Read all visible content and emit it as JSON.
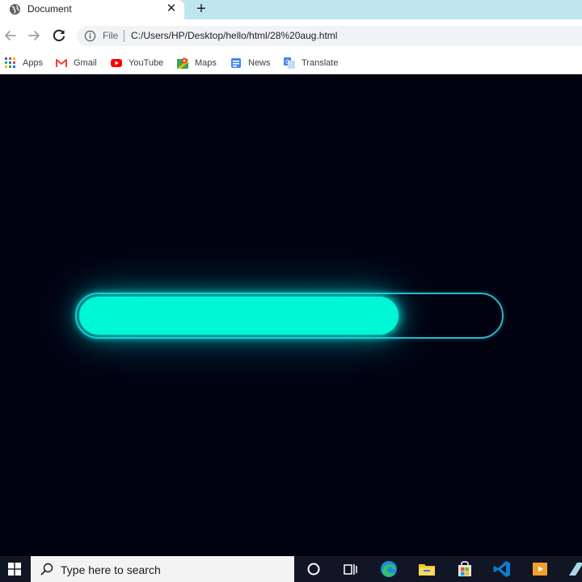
{
  "browser": {
    "tab": {
      "title": "Document",
      "close_glyph": "✕"
    },
    "new_tab_glyph": "+",
    "address": {
      "scheme_label": "File",
      "url": "C:/Users/HP/Desktop/hello/html/28%20aug.html"
    },
    "bookmarks": [
      {
        "label": "Apps",
        "icon": "apps-grid-icon"
      },
      {
        "label": "Gmail",
        "icon": "gmail-icon"
      },
      {
        "label": "YouTube",
        "icon": "youtube-icon"
      },
      {
        "label": "Maps",
        "icon": "maps-icon"
      },
      {
        "label": "News",
        "icon": "news-icon"
      },
      {
        "label": "Translate",
        "icon": "translate-icon"
      }
    ]
  },
  "page": {
    "progress": {
      "value_fraction": 0.76,
      "fill_color": "#00f7d6",
      "track_color": "#2ab7c9",
      "background": "#000210"
    }
  },
  "taskbar": {
    "search_placeholder": "Type here to search",
    "icons": [
      "windows-start-icon",
      "cortana-icon",
      "task-view-icon",
      "edge-icon",
      "file-explorer-icon",
      "store-icon",
      "vscode-icon",
      "media-player-icon"
    ]
  }
}
